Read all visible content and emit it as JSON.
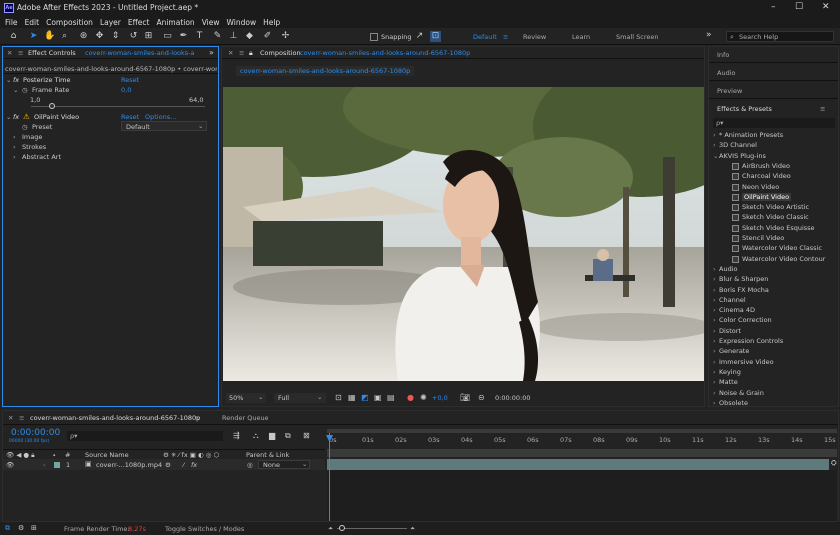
{
  "app": {
    "logo_text": "Ae",
    "title": "Adobe After Effects 2023 - Untitled Project.aep *",
    "window_controls": [
      "–",
      "☐",
      "✕"
    ]
  },
  "menu": [
    "File",
    "Edit",
    "Composition",
    "Layer",
    "Effect",
    "Animation",
    "View",
    "Window",
    "Help"
  ],
  "toolbar": {
    "snapping_label": "Snapping",
    "workspaces": [
      {
        "label": "Default",
        "active": true
      },
      {
        "label": "Review",
        "active": false
      },
      {
        "label": "Learn",
        "active": false
      },
      {
        "label": "Small Screen",
        "active": false
      }
    ],
    "search_placeholder": "Search Help",
    "overflow": "»"
  },
  "effect_controls": {
    "tab_label": "Effect Controls",
    "tab_layer": "coverr-woman-smiles-and-looks-arou",
    "breadcrumb": "coverr-woman-smiles-and-looks-around-6567-1080p • coverr-woman-sm",
    "posterize": {
      "name": "Posterize Time",
      "reset": "Reset",
      "frame_rate_label": "Frame Rate",
      "frame_rate_value": "0,0",
      "slider_min": "1,0",
      "slider_max": "64,0",
      "slider_fraction": 0.0
    },
    "oilpaint": {
      "name": "OilPaint Video",
      "reset": "Reset",
      "options": "Options...",
      "preset_label": "Preset",
      "preset_value": "Default",
      "groups": [
        "Image",
        "Strokes",
        "Abstract Art"
      ]
    }
  },
  "composition": {
    "tab_label": "Composition",
    "tab_comp": "coverr-woman-smiles-and-looks-around-6567-1080p",
    "sub_tab": "coverr-woman-smiles-and-looks-around-6567-1080p",
    "zoom": "50%",
    "resolution": "Full",
    "exposure": "+0,0",
    "timecode": "0:00:00:00"
  },
  "right_panels": {
    "info": "Info",
    "audio": "Audio",
    "preview": "Preview",
    "effects_presets": "Effects & Presets",
    "search_placeholder": "ρ▾",
    "tree": [
      {
        "label": "* Animation Presets",
        "indent": 0,
        "arrow": "›"
      },
      {
        "label": "3D Channel",
        "indent": 0,
        "arrow": "›"
      },
      {
        "label": "AKVIS Plug-ins",
        "indent": 0,
        "arrow": "⌄"
      },
      {
        "label": "AirBrush Video",
        "indent": 1,
        "arrow": ""
      },
      {
        "label": "Charcoal Video",
        "indent": 1,
        "arrow": ""
      },
      {
        "label": "Neon Video",
        "indent": 1,
        "arrow": ""
      },
      {
        "label": "OilPaint Video",
        "indent": 1,
        "arrow": "",
        "selected": true
      },
      {
        "label": "Sketch Video Artistic",
        "indent": 1,
        "arrow": ""
      },
      {
        "label": "Sketch Video Classic",
        "indent": 1,
        "arrow": ""
      },
      {
        "label": "Sketch Video Esquisse",
        "indent": 1,
        "arrow": ""
      },
      {
        "label": "Stencil Video",
        "indent": 1,
        "arrow": ""
      },
      {
        "label": "Watercolor Video Classic",
        "indent": 1,
        "arrow": ""
      },
      {
        "label": "Watercolor Video Contour",
        "indent": 1,
        "arrow": ""
      },
      {
        "label": "Audio",
        "indent": 0,
        "arrow": "›"
      },
      {
        "label": "Blur & Sharpen",
        "indent": 0,
        "arrow": "›"
      },
      {
        "label": "Boris FX Mocha",
        "indent": 0,
        "arrow": "›"
      },
      {
        "label": "Channel",
        "indent": 0,
        "arrow": "›"
      },
      {
        "label": "Cinema 4D",
        "indent": 0,
        "arrow": "›"
      },
      {
        "label": "Color Correction",
        "indent": 0,
        "arrow": "›"
      },
      {
        "label": "Distort",
        "indent": 0,
        "arrow": "›"
      },
      {
        "label": "Expression Controls",
        "indent": 0,
        "arrow": "›"
      },
      {
        "label": "Generate",
        "indent": 0,
        "arrow": "›"
      },
      {
        "label": "Immersive Video",
        "indent": 0,
        "arrow": "›"
      },
      {
        "label": "Keying",
        "indent": 0,
        "arrow": "›"
      },
      {
        "label": "Matte",
        "indent": 0,
        "arrow": "›"
      },
      {
        "label": "Noise & Grain",
        "indent": 0,
        "arrow": "›"
      },
      {
        "label": "Obsolete",
        "indent": 0,
        "arrow": "›"
      }
    ]
  },
  "timeline": {
    "tab_label": "coverr-woman-smiles-and-looks-around-6567-1080p",
    "render_queue": "Render Queue",
    "timecode": "0:00:00:00",
    "fps": "00000 (30.00 fps)",
    "search_placeholder": "ρ▾",
    "col_source": "Source Name",
    "col_parent": "Parent & Link",
    "layer_index": "1",
    "layer_name": "coverr-...1080p.mp4",
    "layer_parent": "None",
    "ruler": [
      "0s",
      "01s",
      "02s",
      "03s",
      "04s",
      "05s",
      "06s",
      "07s",
      "08s",
      "09s",
      "10s",
      "11s",
      "12s",
      "13s",
      "14s",
      "15s"
    ]
  },
  "status": {
    "render_time_label": "Frame Render Time:",
    "render_time_value": "8,27s",
    "toggle_label": "Toggle Switches / Modes"
  },
  "colors": {
    "accent": "#2d8ceb",
    "layer_bar": "#5e7a7a",
    "render_time": "#e0473c"
  }
}
